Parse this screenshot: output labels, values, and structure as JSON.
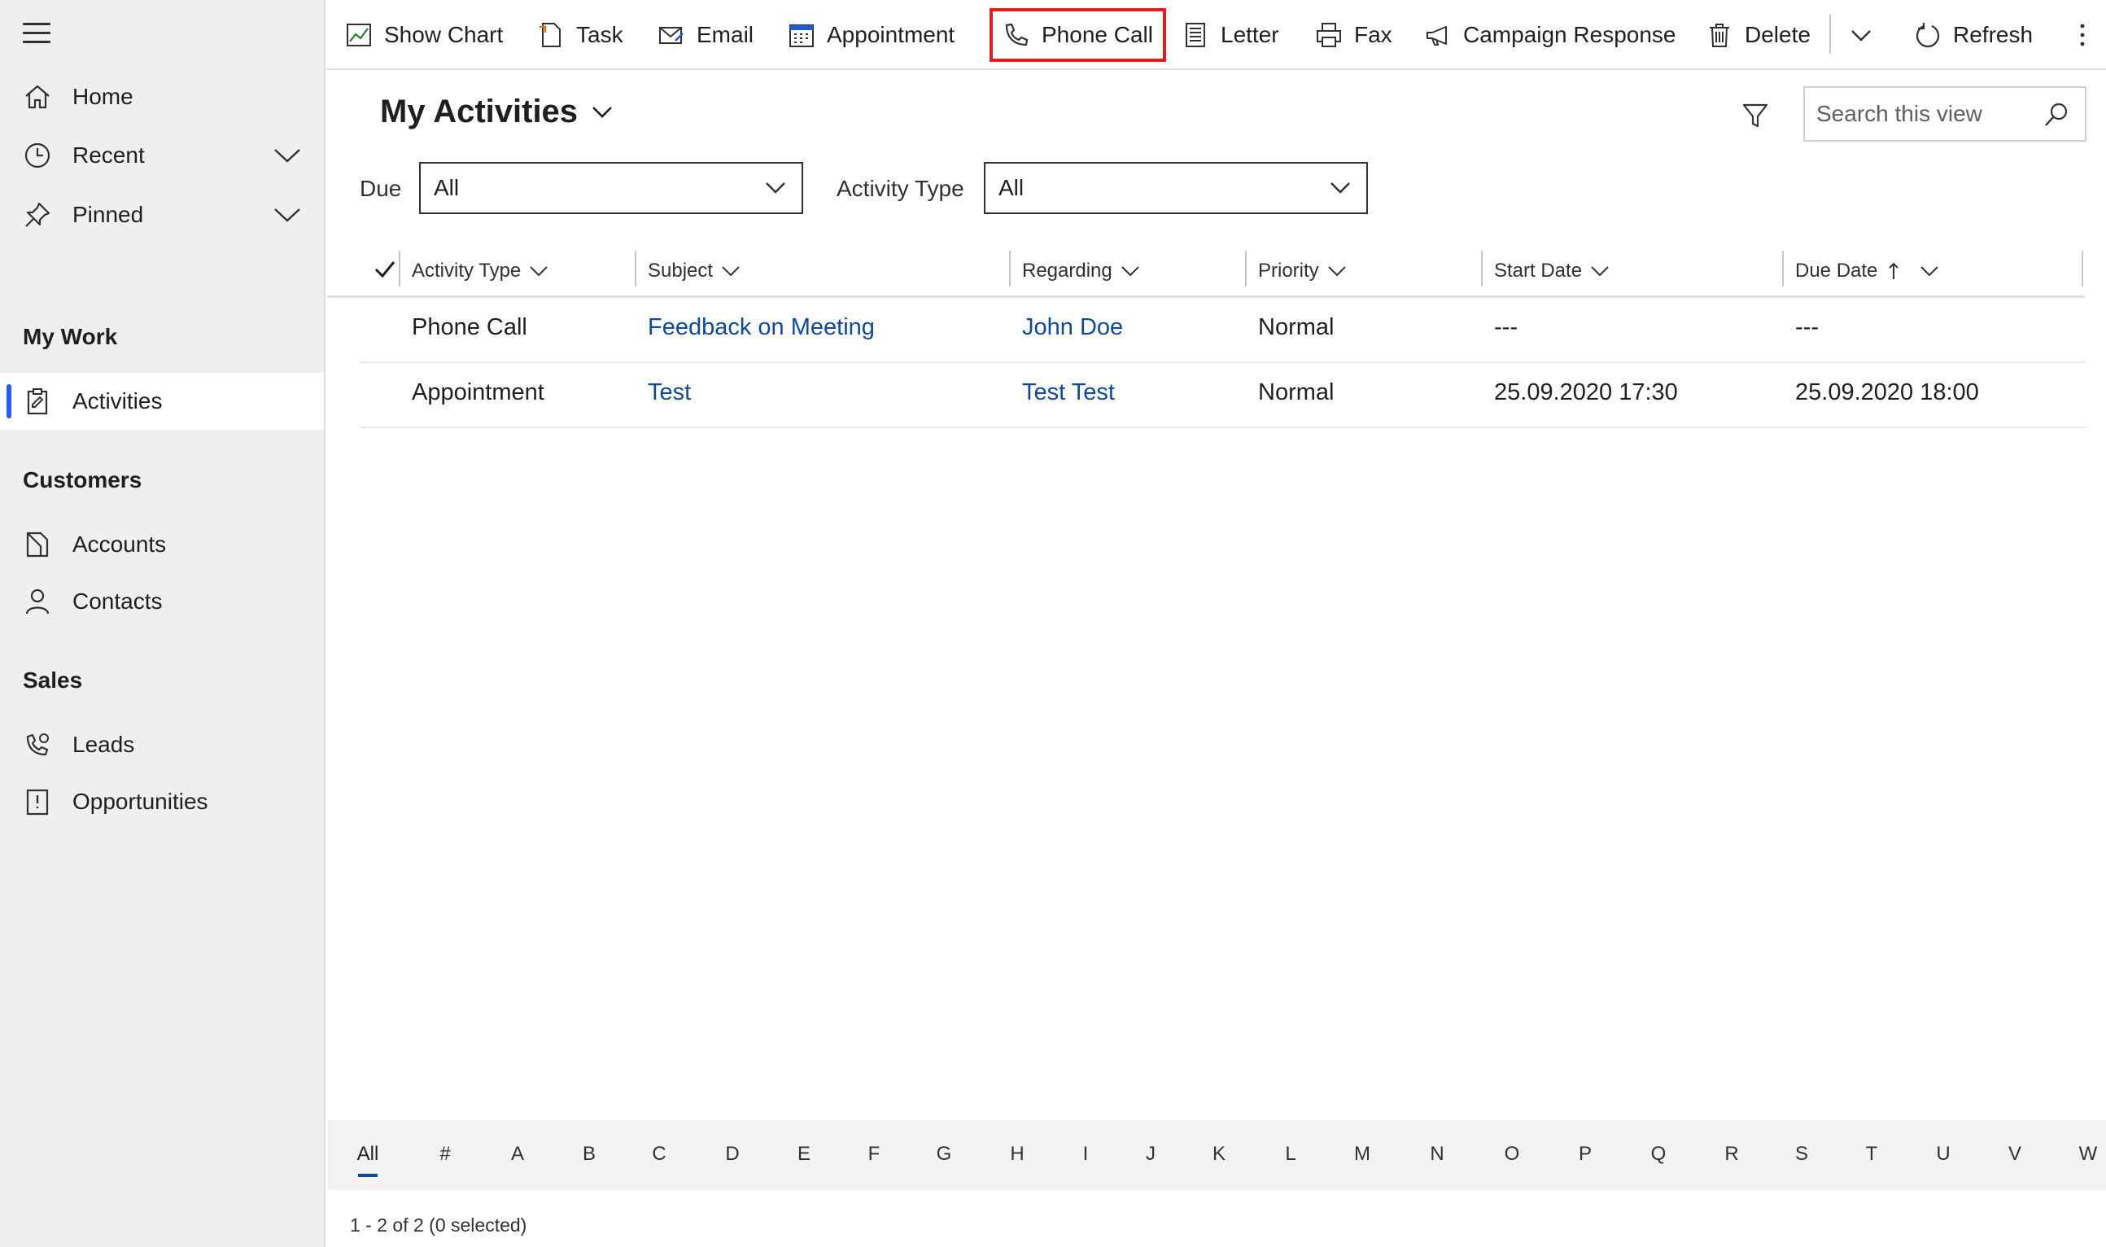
{
  "sidebar": {
    "top_items": [
      {
        "label": "Home",
        "icon": "home-icon"
      },
      {
        "label": "Recent",
        "icon": "clock-icon"
      },
      {
        "label": "Pinned",
        "icon": "pin-icon"
      }
    ],
    "groups": [
      {
        "title": "My Work",
        "items": [
          {
            "label": "Activities",
            "icon": "clipboard-icon",
            "selected": true
          }
        ]
      },
      {
        "title": "Customers",
        "items": [
          {
            "label": "Accounts",
            "icon": "accounts-icon"
          },
          {
            "label": "Contacts",
            "icon": "person-icon"
          }
        ]
      },
      {
        "title": "Sales",
        "items": [
          {
            "label": "Leads",
            "icon": "leads-icon"
          },
          {
            "label": "Opportunities",
            "icon": "opportunities-icon"
          }
        ]
      }
    ]
  },
  "commands": {
    "show_chart": "Show Chart",
    "task": "Task",
    "email": "Email",
    "appointment": "Appointment",
    "phone_call": "Phone Call",
    "letter": "Letter",
    "fax": "Fax",
    "campaign_response": "Campaign Response",
    "delete": "Delete",
    "refresh": "Refresh"
  },
  "view": {
    "title": "My Activities",
    "search_placeholder": "Search this view",
    "filters": {
      "due_label": "Due",
      "due_value": "All",
      "activity_type_label": "Activity Type",
      "activity_type_value": "All"
    }
  },
  "grid": {
    "columns": [
      "Activity Type",
      "Subject",
      "Regarding",
      "Priority",
      "Start Date",
      "Due Date"
    ],
    "rows": [
      [
        "Phone Call",
        "Feedback on Meeting",
        "John Doe",
        "Normal",
        "---",
        "---"
      ],
      [
        "Appointment",
        "Test",
        "Test Test",
        "Normal",
        "25.09.2020 17:30",
        "25.09.2020 18:00"
      ]
    ]
  },
  "jumpbar": [
    "All",
    "#",
    "A",
    "B",
    "C",
    "D",
    "E",
    "F",
    "G",
    "H",
    "I",
    "J",
    "K",
    "L",
    "M",
    "N",
    "O",
    "P",
    "Q",
    "R",
    "S",
    "T",
    "U",
    "V",
    "W"
  ],
  "status": "1 - 2 of 2 (0 selected)",
  "colors": {
    "accent": "#2b5aed",
    "link": "#11489a",
    "highlight": "#e02020"
  }
}
